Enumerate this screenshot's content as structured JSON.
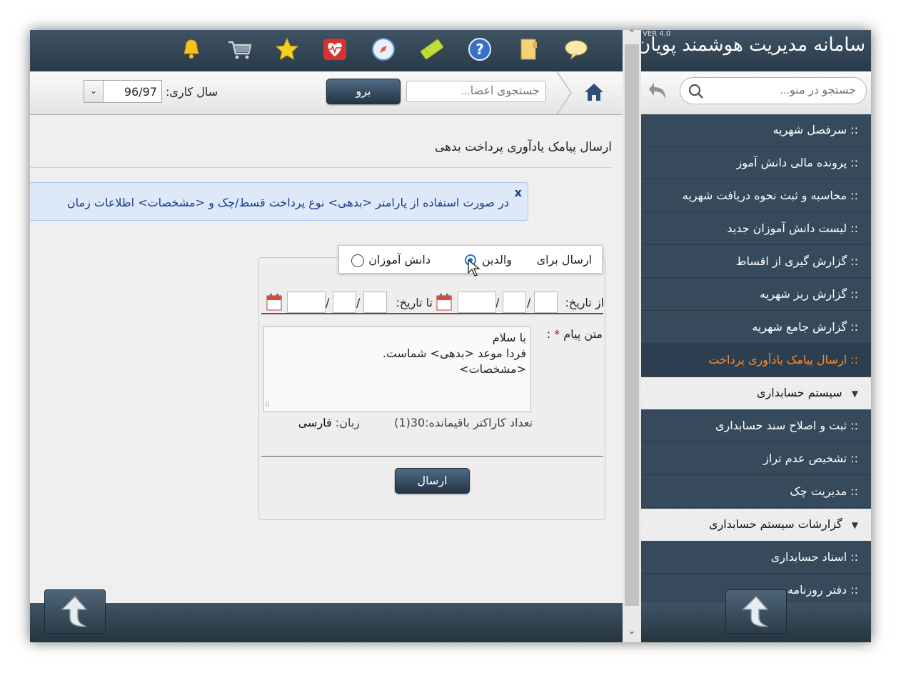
{
  "app": {
    "brand": "سامانه مدیریت هوشمند پویان",
    "version": "VER 4.0"
  },
  "toolbar": {
    "menu_search_placeholder": "جستجو در منو...",
    "member_search_placeholder": "جستجوی اعضا...",
    "go_label": "برو",
    "year_label": "سال کاری:",
    "year_value": "96/97"
  },
  "top_icons": [
    "chat-bubble-icon",
    "notebook-icon",
    "help-icon",
    "ticket-icon",
    "compass-icon",
    "heart-monitor-icon",
    "star-icon",
    "shopping-cart-icon",
    "bell-icon"
  ],
  "sidebar": {
    "items": [
      {
        "label": ":: سرفصل شهریه"
      },
      {
        "label": ":: پرونده مالی دانش آموز"
      },
      {
        "label": ":: محاسبه و ثبت نحوه دریافت شهریه"
      },
      {
        "label": ":: لیست دانش آموزان جدید"
      },
      {
        "label": ":: گزارش گیری از اقساط"
      },
      {
        "label": ":: گزارش ریز شهریه"
      },
      {
        "label": ":: گزارش جامع شهریه"
      },
      {
        "label": ":: ارسال پیامک یادآوری پرداخت"
      }
    ],
    "section_accounting": "سیستم حسابداری",
    "accounting_items": [
      {
        "label": ":: ثبت و اصلاح سند حسابداری"
      },
      {
        "label": ":: تشخیص عدم تراز"
      },
      {
        "label": ":: مدیریت چک"
      }
    ],
    "section_reports": "گزارشات سیستم حسابداری",
    "report_items": [
      {
        "label": ":: اسناد حسابداری"
      },
      {
        "label": ":: دفتر روزنامه"
      }
    ]
  },
  "main": {
    "page_title": "ارسال پیامک یادآوری پرداخت بدهی",
    "info_text": "در صورت استفاده از پارامتر <بدهی> نوع پرداخت قسط/چک و <مشخصات> اطلاعات زمان",
    "info_close": "x",
    "send_to_label": "ارسال برای",
    "option_parents": "والدین",
    "option_students": "دانش آموزان",
    "from_date_label": "از تاریخ:",
    "to_date_label": "تا تاریخ:",
    "date_separator": "/",
    "message_label": "متن پیام",
    "required_mark": "*",
    "message_colon": ":",
    "message_text": "با سلام\nفردا موعد <بدهی> شماست.\n<مشخصات>",
    "remaining_label": "تعداد کاراکتر باقیمانده:",
    "remaining_value": "30(1)",
    "language_label": "زبان:",
    "language_value": "فارسی",
    "send_label": "ارسال"
  },
  "colors": {
    "header_dark": "#2f4252",
    "sidebar_bg": "#364a5c",
    "active_item": "#ff8c2e",
    "info_bg": "#dde9f9",
    "link_blue": "#1a3c8a"
  }
}
